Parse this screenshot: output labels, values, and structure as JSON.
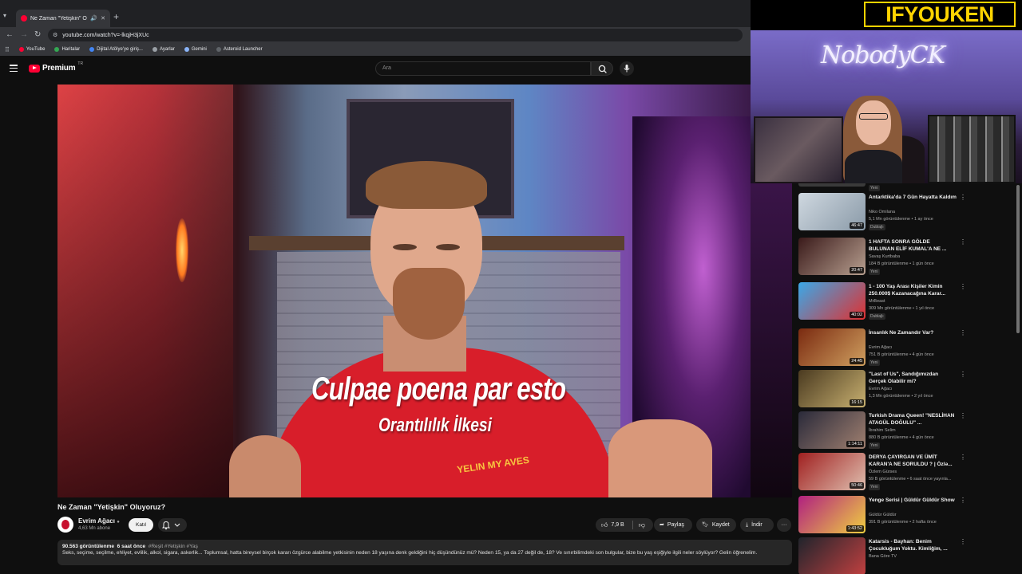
{
  "browser": {
    "tab_title": "Ne Zaman \"Yetişkin\" Oluyor...",
    "url": "youtube.com/watch?v=-lkqjH3jXUc",
    "bookmarks": [
      {
        "label": "YouTube",
        "color": "#ff0033"
      },
      {
        "label": "Haritalar",
        "color": "#34a853"
      },
      {
        "label": "Dijital Atölye'ye giriş...",
        "color": "#4285f4"
      },
      {
        "label": "Ayarlar",
        "color": "#9aa0a6"
      },
      {
        "label": "Gemini",
        "color": "#8ab4f8"
      },
      {
        "label": "Asteroid Launcher",
        "color": "#5f6368"
      }
    ]
  },
  "youtube": {
    "logo_text": "Premium",
    "logo_country": "TR",
    "search_placeholder": "Ara"
  },
  "video": {
    "subtitle_main": "Culpae poena par esto",
    "subtitle_secondary": "Orantılılık İlkesi",
    "shirt_text": "YELIN MY AVES",
    "title": "Ne Zaman \"Yetişkin\" Oluyoruz?",
    "channel": "Evrim Ağacı",
    "subscribers": "4,63 Mn abone",
    "join_label": "Katıl",
    "likes": "7,9 B",
    "share_label": "Paylaş",
    "save_label": "Kaydet",
    "download_label": "İndir",
    "more_label": "···",
    "views": "90.563 görüntülenme",
    "age": "6 saat önce",
    "tags": "#Reşit #Yetişkin #Yaş",
    "description": "Seks, seçime, seçilme, ehliyet, evlilik, alkol, sigara, askerlik... Toplumsal, hatta bireysel birçok kararı özgürce alabilme yetkisinin neden 18 yaşına denk geldiğini hiç düşündünüz mü? Neden 15, ya da 27 değil de, 18? Ve sınırbilimdeki son bulgular, bize bu yaş eşiğiyle ilgili neler söylüyor? Gelin öğrenelim."
  },
  "recommendations": [
    {
      "title": "Antarktika'da 7 Gün Hayatta Kaldım",
      "channel": "Niko Omilana",
      "meta": "5,1 Mn görüntülenme • 1 ay önce",
      "badge": "Dublajlı",
      "duration": "46:47",
      "colors": [
        "#cfd8e0",
        "#8a9aa8"
      ]
    },
    {
      "title": "1 HAFTA SONRA GÖLDE BULUNAN ELİF KUMAL'A NE ...",
      "channel": "Savaş Kurtbaba",
      "meta": "184 B görüntülenme • 1 gün önce",
      "badge": "Yeni",
      "duration": "20:47",
      "colors": [
        "#3a1a1a",
        "#b8a090"
      ]
    },
    {
      "title": "1 - 100 Yaş Arası Kişiler Kimin 250.000$ Kazanacağına Karar...",
      "channel": "MrBeast",
      "meta": "309 Mn görüntülenme • 1 yıl önce",
      "badge": "Dublajlı",
      "duration": "40:02",
      "colors": [
        "#3aa8e8",
        "#e03030"
      ]
    },
    {
      "title": "İnsanlık Ne Zamandır Var?",
      "channel": "Evrim Ağacı",
      "meta": "751 B görüntülenme • 4 gün önce",
      "badge": "Yeni",
      "duration": "24:45",
      "colors": [
        "#7a2a10",
        "#d0a060"
      ]
    },
    {
      "title": "\"Last of Us\", Sandığımızdan Gerçek Olabilir mi?",
      "channel": "Evrim Ağacı",
      "meta": "1,3 Mn görüntülenme • 2 yıl önce",
      "badge": "",
      "duration": "16:15",
      "colors": [
        "#4a3a20",
        "#c8b070"
      ]
    },
    {
      "title": "Turkish Drama Queen! \"NESLİHAN ATAGÜL DOĞULU\" ...",
      "channel": "İbrahim Selim",
      "meta": "880 B görüntülenme • 4 gün önce",
      "badge": "Yeni",
      "duration": "1:14:11",
      "colors": [
        "#2a2a3a",
        "#a08070"
      ]
    },
    {
      "title": "DERYA ÇAYIRGAN VE ÜMİT KARAN'A NE SORULDU ? | Özlə...",
      "channel": "Özlem Gürses",
      "meta": "59 B görüntülenme • 6 saat önce yayınla...",
      "badge": "Yeni",
      "duration": "50:46",
      "colors": [
        "#a02020",
        "#e0c0b0"
      ]
    },
    {
      "title": "Yenge Serisi | Güldür Güldür Show",
      "channel": "Güldür Güldür",
      "meta": "391 B görüntülenme • 2 hafta önce",
      "badge": "",
      "duration": "1:43:52",
      "colors": [
        "#b02080",
        "#f0d040"
      ]
    },
    {
      "title": "Katarsis - Bayhan: Benim Çocukluğum Yoktu. Kimliğim, ...",
      "channel": "Bana Göre TV",
      "meta": "",
      "badge": "",
      "duration": "",
      "colors": [
        "#20242c",
        "#c04040"
      ]
    }
  ],
  "overlay": {
    "brand_text": "IFYOUKEN",
    "neon_text": "NobodyCK"
  }
}
